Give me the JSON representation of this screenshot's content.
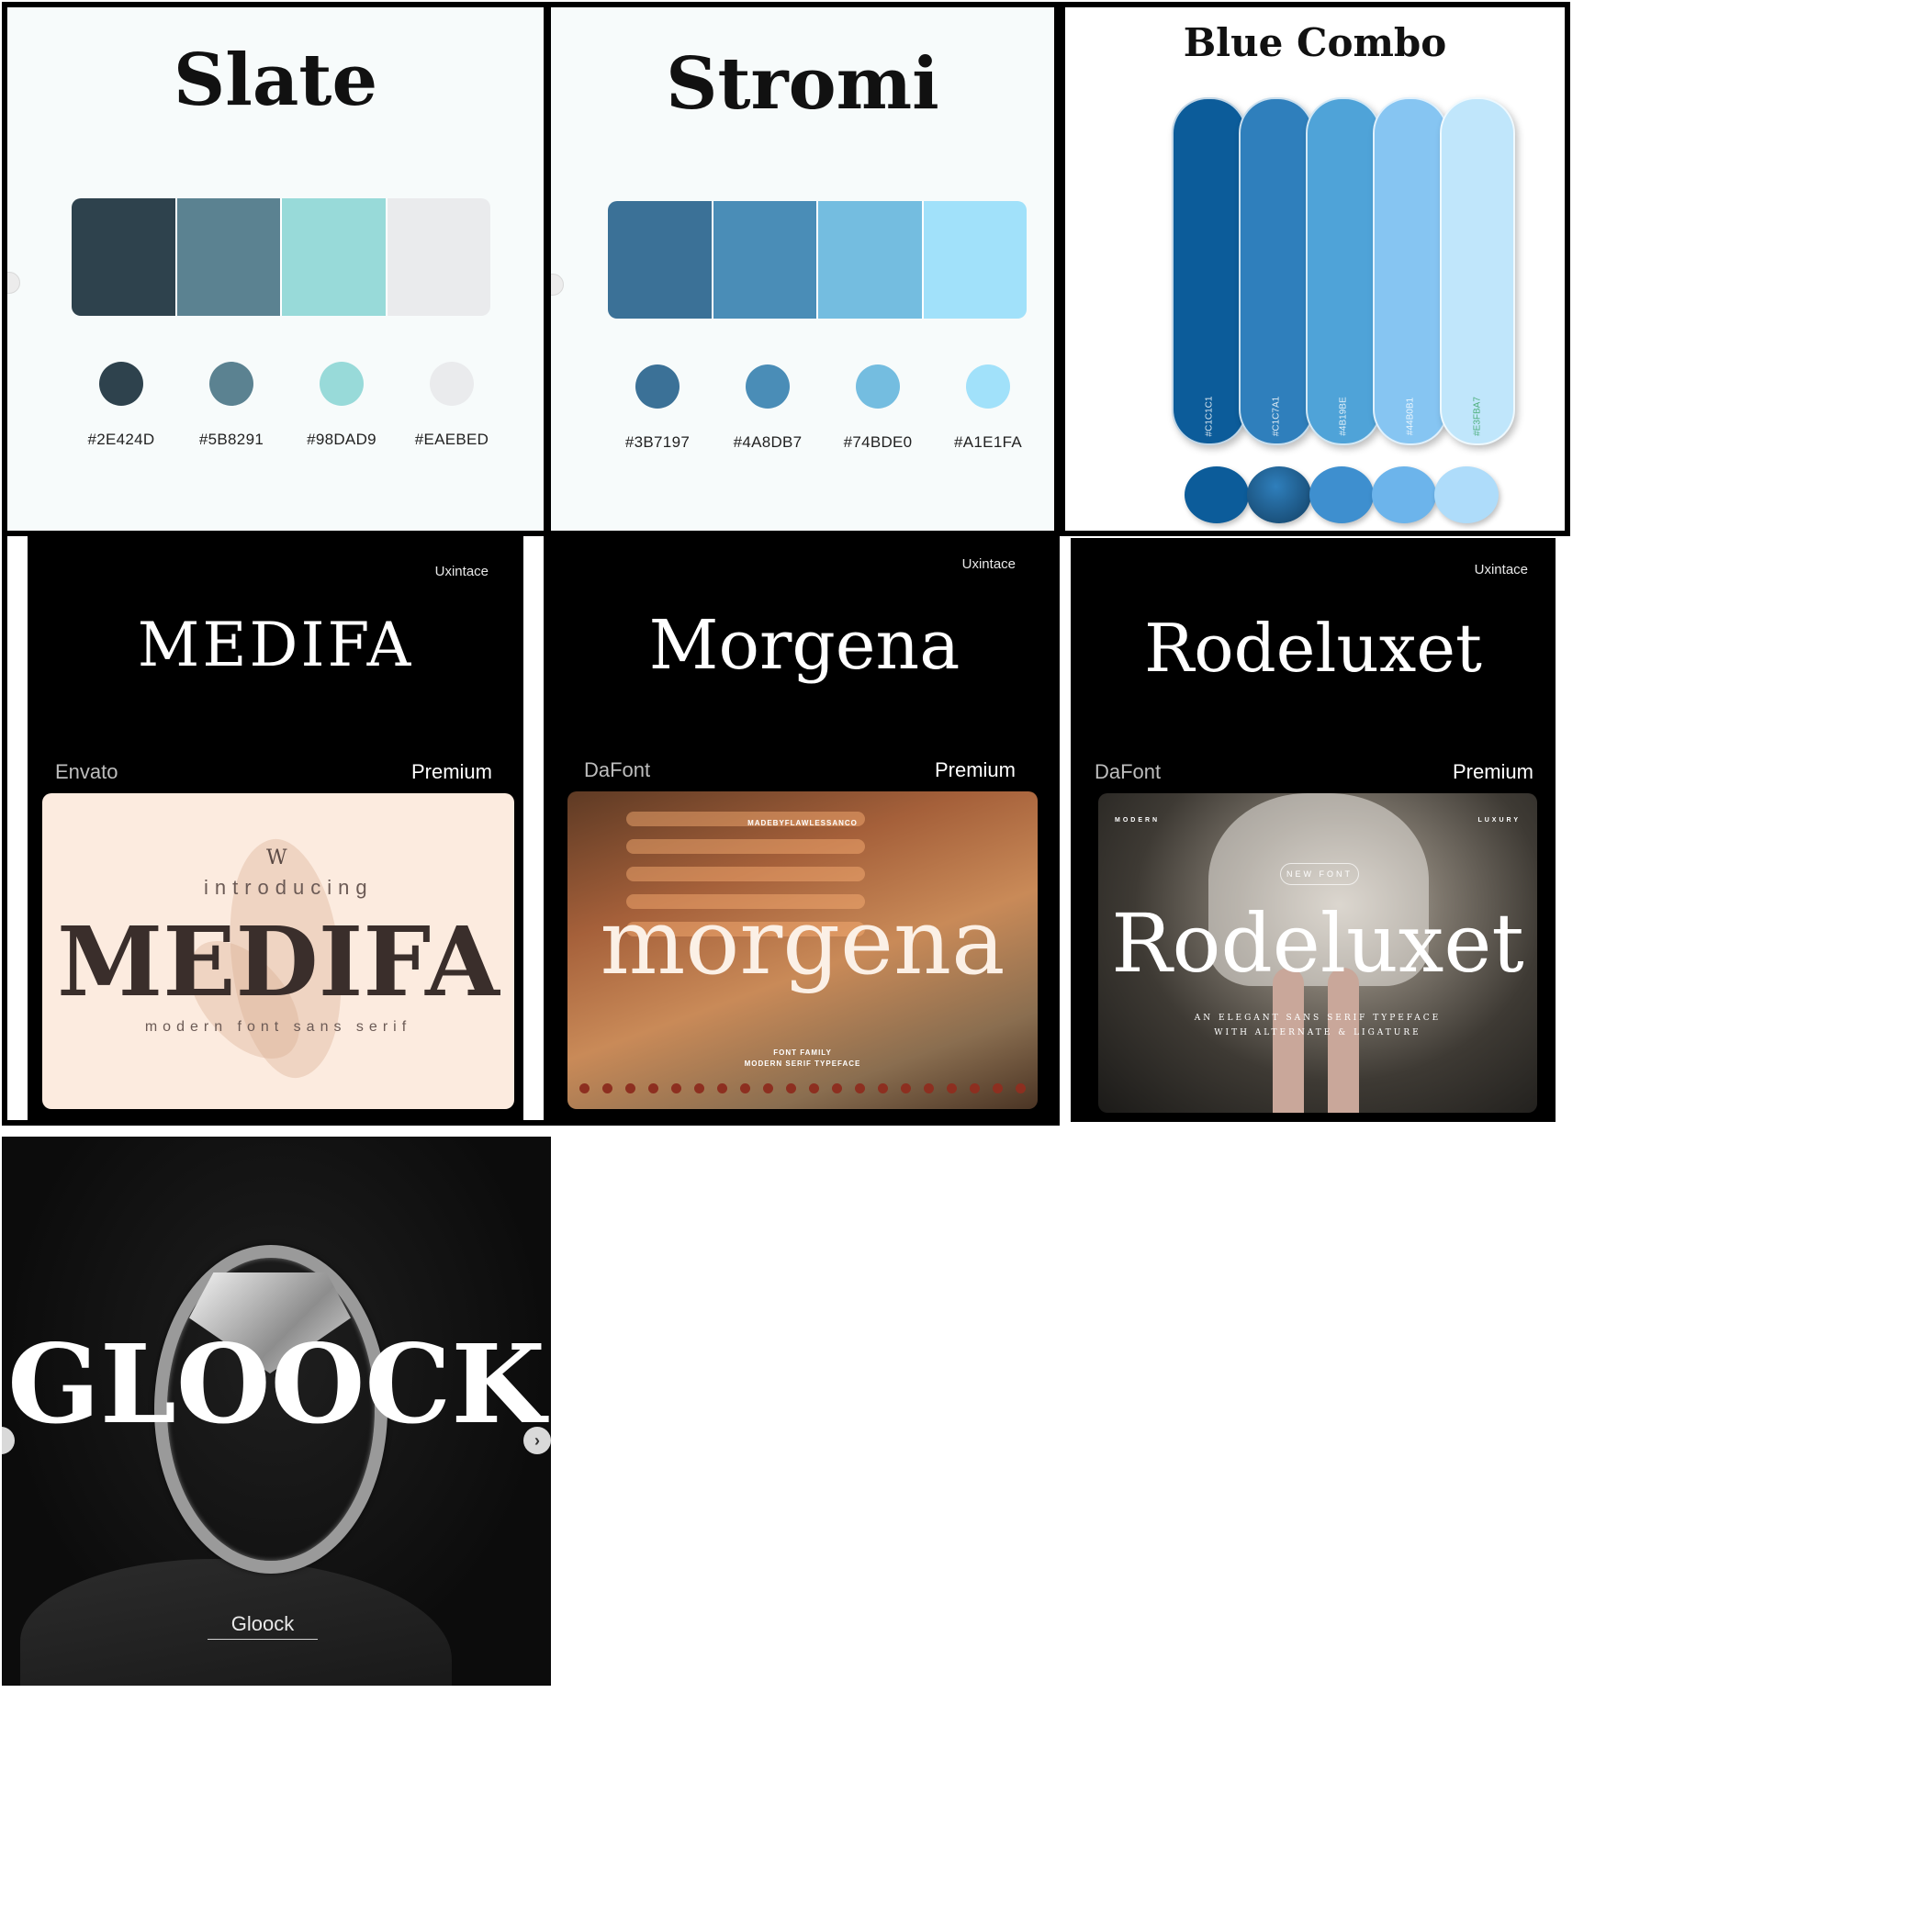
{
  "palettes": [
    {
      "title": "Slate",
      "colors": [
        "#2E424D",
        "#5B8291",
        "#98DAD9",
        "#EAEBED"
      ],
      "hex_labels": [
        "#2E424D",
        "#5B8291",
        "#98DAD9",
        "#EAEBED"
      ]
    },
    {
      "title": "Stromi",
      "colors": [
        "#3B7197",
        "#4A8DB7",
        "#74BDE0",
        "#A1E1FA"
      ],
      "hex_labels": [
        "#3B7197",
        "#4A8DB7",
        "#74BDE0",
        "#A1E1FA"
      ]
    },
    {
      "title": "Blue Combo",
      "colors": [
        "#0C5C9A",
        "#2F7FBC",
        "#4FA3D8",
        "#86C5F2",
        "#C0E6FB"
      ],
      "pill_labels": [
        "#C1C1C1",
        "#C1C7A1",
        "#4B19BE",
        "#44B0B1",
        "#E3FBA7"
      ]
    }
  ],
  "fonts": [
    {
      "maker": "Uxintace",
      "name": "MEDIFA",
      "source": "Envato",
      "tier": "Premium",
      "preview": {
        "monogram": "W",
        "intro": "introducing",
        "title": "MEDIFA",
        "subtitle": "modern font sans serif"
      }
    },
    {
      "maker": "Uxintace",
      "name": "Morgena",
      "source": "DaFont",
      "tier": "Premium",
      "preview": {
        "credit": "MADEBYFLAWLESSANCO",
        "title": "morgena",
        "line1": "FONT FAMILY",
        "line2": "MODERN SERIF TYPEFACE"
      }
    },
    {
      "maker": "Uxintace",
      "name": "Rodeluxet",
      "source": "DaFont",
      "tier": "Premium",
      "preview": {
        "corner_left": "MODERN",
        "corner_right": "LUXURY",
        "badge": "NEW FONT",
        "title": "Rodeluxet",
        "line1": "AN ELEGANT SANS SERIF TYPEFACE",
        "line2": "WITH ALTERNATE & LIGATURE"
      }
    }
  ],
  "gloock": {
    "title": "GLOOCK",
    "label": "Gloock",
    "next_icon": "›"
  }
}
